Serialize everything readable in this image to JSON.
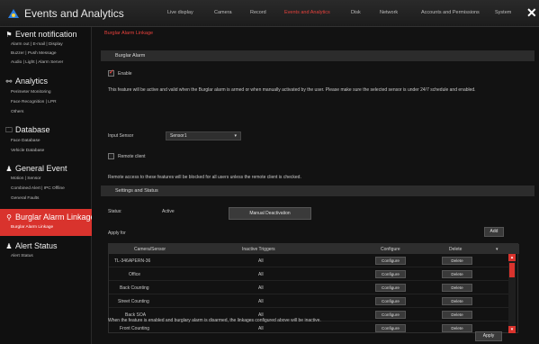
{
  "app": {
    "title": "Events and Analytics",
    "close": "✕"
  },
  "topnav": [
    {
      "label": "Live display",
      "active": false
    },
    {
      "label": "Camera",
      "active": false
    },
    {
      "label": "Record",
      "active": false
    },
    {
      "label": "Events and Analytics",
      "active": true
    },
    {
      "label": "Disk",
      "active": false
    },
    {
      "label": "Network",
      "active": false
    },
    {
      "label": "Accounts and Permissions",
      "active": false
    },
    {
      "label": "System",
      "active": false
    }
  ],
  "sidebar": {
    "event_notification": {
      "title": "Event notification",
      "icon": "flag-icon",
      "items": [
        "Alarm out  |  E-mail  |  Display",
        "Buzzer  |  Push Message",
        "Audio  |  Light  |  Alarm Server"
      ]
    },
    "analytics": {
      "title": "Analytics",
      "icon": "analytics-icon",
      "items": [
        "Perimeter Monitoring",
        "Face Recognition  |  LPR",
        "Others"
      ]
    },
    "database": {
      "title": "Database",
      "icon": "database-icon",
      "items": [
        "Face Database",
        "Vehicle Database"
      ]
    },
    "general_event": {
      "title": "General Event",
      "icon": "person-icon",
      "items": [
        "Motion  |  Sensor",
        "Combined Alert  |  IPC Offline",
        "General Faults"
      ]
    },
    "burglar_alarm": {
      "title": "Burglar Alarm Linkage",
      "icon": "location-pin-icon",
      "items": [
        "Burglar Alarm Linkage"
      ]
    },
    "alert_status": {
      "title": "Alert Status",
      "icon": "person-icon",
      "items": [
        "Alert Status"
      ]
    }
  },
  "main": {
    "breadcrumb": "Burglar Alarm Linkage",
    "burglar_alarm_header": "Burglar Alarm",
    "enable_label": "Enable",
    "enable_checked": true,
    "description": "This feature will be active and valid when the Burglar alarm is armed or when manually activated by the user. Please make sure the selected sensor is under 24/7 schedule and enabled.",
    "input_sensor_label": "Input Sensor",
    "input_sensor_value": "Sensor1",
    "remote_client_label": "Remote client",
    "remote_client_checked": false,
    "remote_note": "Remote access to these features will be blocked for all users unless the remote client is checked.",
    "settings_header": "Settings and Status",
    "status_label": "Status:",
    "status_value": "Active",
    "manual_deactivation": "Manual Deactivation",
    "apply_for": "Apply for",
    "add": "Add",
    "columns": [
      "Camera/Sensor",
      "Inactive Triggers",
      "Configure",
      "Delete"
    ],
    "rows": [
      {
        "camera": "TL-346APERN-36",
        "triggers": "All",
        "configure": "Configure",
        "delete": "Delete"
      },
      {
        "camera": "Office",
        "triggers": "All",
        "configure": "Configure",
        "delete": "Delete"
      },
      {
        "camera": "Back Counting",
        "triggers": "All",
        "configure": "Configure",
        "delete": "Delete"
      },
      {
        "camera": "Street Counting",
        "triggers": "All",
        "configure": "Configure",
        "delete": "Delete"
      },
      {
        "camera": "Back SOA",
        "triggers": "All",
        "configure": "Configure",
        "delete": "Delete"
      },
      {
        "camera": "Front Counting",
        "triggers": "All",
        "configure": "Configure",
        "delete": "Delete"
      }
    ],
    "footer_note": "When the feature is enabled and burglary alarm is disarmed, the linkages configured above will be inactive.",
    "apply": "Apply"
  },
  "colors": {
    "accent": "#e8413c",
    "active_bg": "#d9332d",
    "bg": "#141414"
  }
}
